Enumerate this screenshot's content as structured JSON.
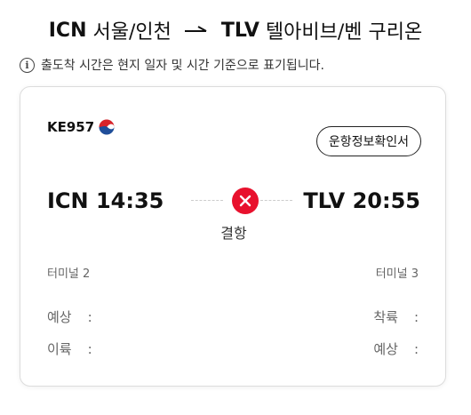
{
  "header": {
    "origin_code": "ICN",
    "origin_city": "서울/인천",
    "destination_code": "TLV",
    "destination_city": "텔아비브/벤 구리온"
  },
  "notice": {
    "text": "출도착 시간은 현지 일자 및 시간 기준으로 표기됩니다."
  },
  "flight": {
    "number": "KE957",
    "ops_button_label": "운항정보확인서",
    "departure": "ICN 14:35",
    "arrival": "TLV 20:55",
    "status": "결항",
    "status_color": "#e8112d",
    "departure_terminal": "터미널 2",
    "arrival_terminal": "터미널 3",
    "left_rows": [
      {
        "label": "예상",
        "sep": ":"
      },
      {
        "label": "이륙",
        "sep": ":"
      }
    ],
    "right_rows": [
      {
        "label": "착륙",
        "sep": ":"
      },
      {
        "label": "예상",
        "sep": ":"
      }
    ]
  }
}
